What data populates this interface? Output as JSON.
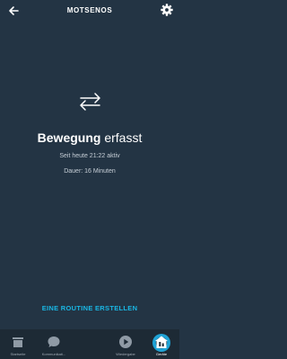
{
  "header": {
    "title": "MOTSENOS",
    "back_icon": "arrow-left-icon",
    "settings_icon": "gear-icon"
  },
  "status": {
    "icon": "motion-arrows-icon",
    "main_bold": "Bewegung",
    "main_rest": " erfasst",
    "active_since": "Seit heute 21:22 aktiv",
    "duration": "Dauer: 16 Minuten"
  },
  "routine_button": "EINE ROUTINE ERSTELLEN",
  "bottom_nav": {
    "items": [
      {
        "label": "Startseite",
        "icon": "home-icon",
        "active": false
      },
      {
        "label": "Kommunikati...",
        "icon": "chat-bubble-icon",
        "active": false
      },
      {
        "label": "",
        "icon": "alexa-ring-icon",
        "active": false
      },
      {
        "label": "Wiedergabe",
        "icon": "play-icon",
        "active": false
      },
      {
        "label": "Geräte",
        "icon": "devices-icon",
        "active": true
      }
    ]
  },
  "colors": {
    "background": "#233444",
    "nav_background": "#1d2a35",
    "accent": "#19b7e5",
    "muted_text": "#c6ced6"
  }
}
